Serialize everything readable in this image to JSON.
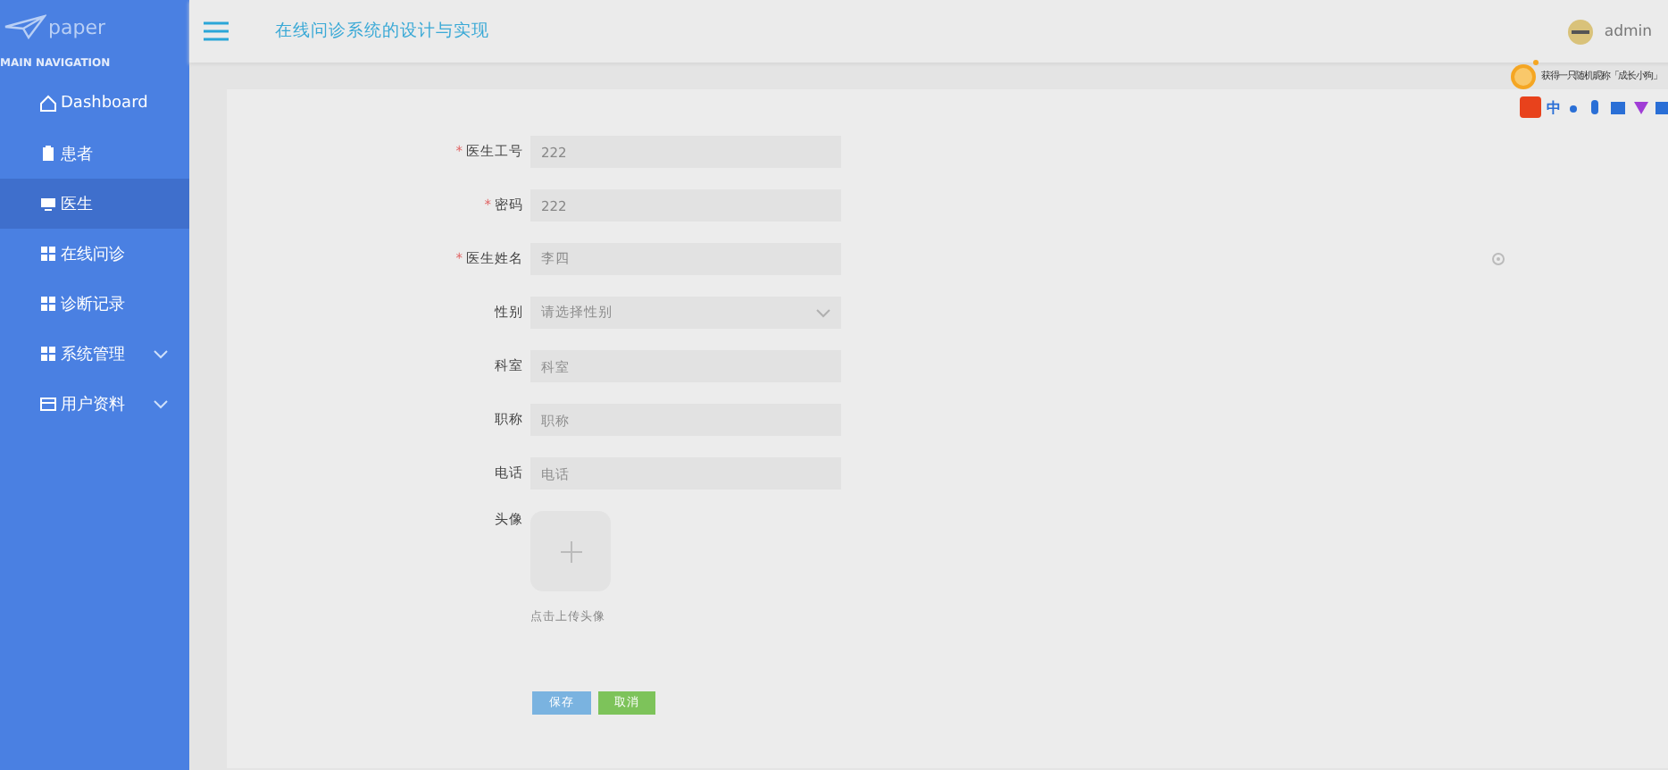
{
  "sidebar": {
    "logo": "paper",
    "section": "MAIN NAVIGATION",
    "items": [
      {
        "label": "Dashboard",
        "selected": false,
        "expandable": false
      },
      {
        "label": "患者",
        "selected": false,
        "expandable": false
      },
      {
        "label": "医生",
        "selected": true,
        "expandable": false
      },
      {
        "label": "在线问诊",
        "selected": false,
        "expandable": false
      },
      {
        "label": "诊断记录",
        "selected": false,
        "expandable": false
      },
      {
        "label": "系统管理",
        "selected": false,
        "expandable": true
      },
      {
        "label": "用户资料",
        "selected": false,
        "expandable": true
      }
    ]
  },
  "header": {
    "title": "在线问诊系统的设计与实现",
    "user": "admin"
  },
  "ime": {
    "tip": "获得一只随机昵称「成长小狗」",
    "labels": [
      "中"
    ]
  },
  "form": {
    "required_mark": "*",
    "fields": [
      {
        "kind": "input",
        "label": "医生工号",
        "required": true,
        "value": "222"
      },
      {
        "kind": "input",
        "label": "密码",
        "required": true,
        "value": "222"
      },
      {
        "kind": "input",
        "label": "医生姓名",
        "required": true,
        "value": "李四"
      },
      {
        "kind": "select",
        "label": "性别",
        "required": false,
        "placeholder": "请选择性别"
      },
      {
        "kind": "input",
        "label": "科室",
        "required": false,
        "placeholder": "科室"
      },
      {
        "kind": "input",
        "label": "职称",
        "required": false,
        "placeholder": "职称"
      },
      {
        "kind": "input",
        "label": "电话",
        "required": false,
        "placeholder": "电话"
      }
    ],
    "avatar": {
      "label": "头像",
      "hint": "点击上传头像"
    },
    "buttons": [
      {
        "label": "保存",
        "kind": "primary"
      },
      {
        "label": "取消",
        "kind": "success"
      }
    ]
  }
}
